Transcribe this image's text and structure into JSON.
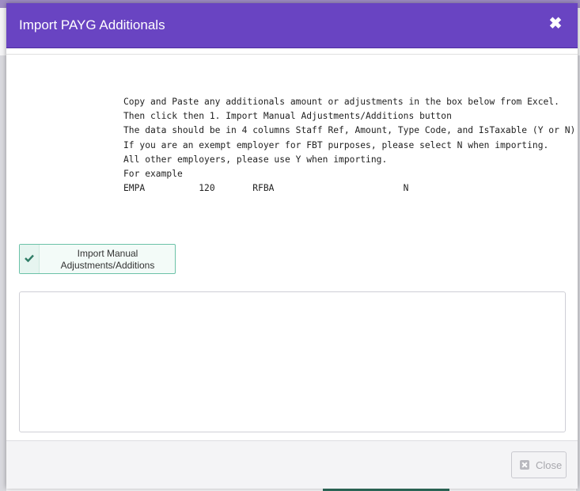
{
  "modal": {
    "title": "Import PAYG Additionals",
    "close_icon": "close-icon",
    "instructions": "Copy and Paste any additionals amount or adjustments in the box below from Excel.\nThen click then 1. Import Manual Adjustments/Additions button\nThe data should be in 4 columns Staff Ref, Amount, Type Code, and IsTaxable (Y or N)\nIf you are an exempt employer for FBT purposes, please select N when importing.\nAll other employers, please use Y when importing.\nFor example\nEMPA          120       RFBA                        N",
    "import_button": {
      "label": "Import Manual Adjustments/Additions",
      "icon": "check-icon"
    },
    "paste_area": {
      "value": ""
    },
    "footer": {
      "close_label": "Close",
      "close_icon": "close-square-icon"
    }
  },
  "colors": {
    "header": "#6944c2",
    "button_border": "#6cc2a8",
    "check": "#2f7d66"
  }
}
